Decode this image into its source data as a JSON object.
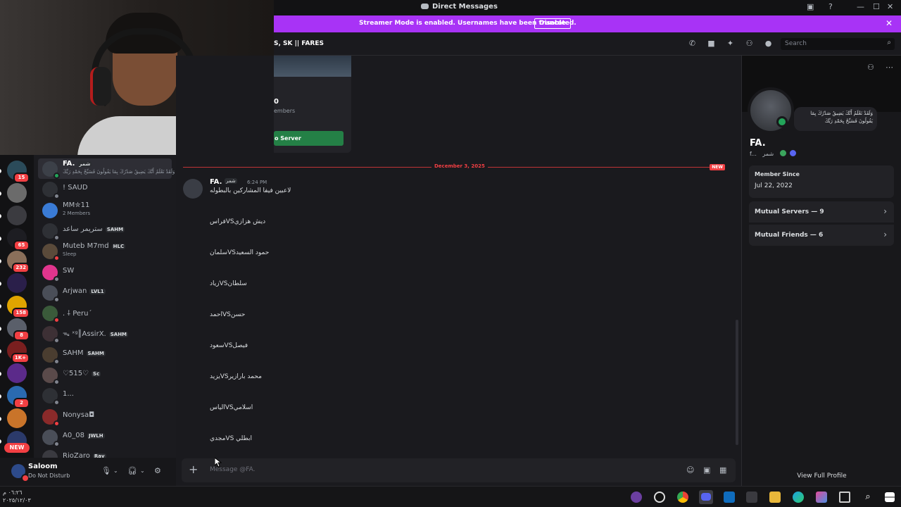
{
  "window": {
    "title": "Direct Messages",
    "controls": [
      "inbox-icon",
      "help-icon",
      "minimize-icon",
      "maximize-icon",
      "close-icon"
    ]
  },
  "banner": {
    "text": "Streamer Mode is enabled. Usernames have been truncated.",
    "button": "Disable"
  },
  "header": {
    "channel_name": "S, SK || FARES",
    "search_placeholder": "Search"
  },
  "servers": [
    {
      "badge": "15",
      "color": "#2b4b5a"
    },
    {
      "badge": "",
      "color": "#6b6b6b"
    },
    {
      "badge": "",
      "color": "#3b3b40"
    },
    {
      "badge": "65",
      "color": "#1d1d22"
    },
    {
      "badge": "232",
      "color": "#8a6f5a"
    },
    {
      "badge": "",
      "color": "#2a1f4a"
    },
    {
      "badge": "158",
      "color": "#e0a400"
    },
    {
      "badge": "8",
      "color": "#5a5f6a"
    },
    {
      "badge": "1K+",
      "color": "#7a1f1f"
    },
    {
      "badge": "",
      "color": "#5b2a8a"
    },
    {
      "badge": "2",
      "color": "#2a6ab0"
    },
    {
      "badge": "",
      "color": "#c9742a"
    },
    {
      "badge": "",
      "color": "#2b3a6a"
    }
  ],
  "rail_new": "NEW",
  "dms": [
    {
      "name": "FA.",
      "tag": "شمر",
      "sub": "وَلَقَدْ نَعْلَمُ أَنَّكَ يَضِيقُ صَدْرُكَ بِمَا يَقُولُونَ فَسَبِّحْ بِحَمْدِ رَبِّكَ",
      "status": "on",
      "selected": true,
      "avatar": "#3c4048"
    },
    {
      "name": "! SAUD",
      "tag": "",
      "sub": "",
      "status": "off",
      "avatar": "#2e3035"
    },
    {
      "name": "MM✮11",
      "tag": "",
      "sub": "2 Members",
      "status": "",
      "avatar": "#3a7bd5"
    },
    {
      "name": "ستريمر ساعد",
      "tag": "SAHM",
      "sub": "",
      "status": "off",
      "avatar": "#2e3035"
    },
    {
      "name": "Muteb M7md",
      "tag": "HLC",
      "sub": "Sleep",
      "status": "dnd",
      "avatar": "#5a4a3a"
    },
    {
      "name": "SW",
      "tag": "",
      "sub": "",
      "status": "off",
      "avatar": "#e0358d"
    },
    {
      "name": "Arjwan",
      "tag": "LVL1",
      "sub": "",
      "status": "off",
      "avatar": "#4a4e58"
    },
    {
      "name": ". ⸸ Peru´",
      "tag": "",
      "sub": "",
      "status": "dnd",
      "avatar": "#3a5a3a"
    },
    {
      "name": "ᯓ ˣᵍ║AssirX.",
      "tag": "SAHM",
      "sub": "",
      "status": "off",
      "avatar": "#3d3035"
    },
    {
      "name": "SAHM",
      "tag": "SAHM",
      "sub": "",
      "status": "off",
      "avatar": "#4a3d30"
    },
    {
      "name": "♡515♡",
      "tag": "Sc",
      "sub": "",
      "status": "off",
      "avatar": "#5a4a4a"
    },
    {
      "name": "1...",
      "tag": "",
      "sub": "",
      "status": "off",
      "avatar": "#2e3035"
    },
    {
      "name": "Nonysa◘",
      "tag": "",
      "sub": "",
      "status": "dnd",
      "avatar": "#8a2a2a"
    },
    {
      "name": "A0_08",
      "tag": "JWLH",
      "sub": "",
      "status": "off",
      "avatar": "#4a4e58"
    },
    {
      "name": "RioZaro",
      "tag": "Rav",
      "sub": "",
      "status": "off",
      "avatar": "#3a3a40"
    }
  ],
  "user": {
    "name": "Saloom",
    "status": "Do Not Disturb"
  },
  "invite": {
    "count": "0",
    "members": "embers",
    "button": "o Server"
  },
  "chat": {
    "date": "December 3, 2025",
    "new_label": "NEW",
    "author": "FA.",
    "author_tag": "شمر",
    "time": "6:24 PM",
    "lines": [
      "لاعبين فيفا المشاركين بالبطوله",
      "فراسVSديش هزازي",
      "سلمانVSحمود السعيد",
      "زيادVSسلطان",
      "احمدVSحسن",
      "سعودVSفيصل",
      "يزيدVSمحمد بارازير",
      "الياسVSاسلامي",
      "مجديVS ابطلي"
    ],
    "composer_placeholder": "Message @FA."
  },
  "profile": {
    "display_name": "FA.",
    "username": "f...",
    "tag": "شمر",
    "bio": "وَلَقَدْ نَعْلَمُ أَنَّكَ يَضِيقُ صَدْرُكَ بِمَا يَقُولُونَ فَسَبِّحْ بِحَمْدِ رَبِّكَ",
    "member_since_label": "Member Since",
    "member_since": "Jul 22, 2022",
    "mutual_servers": "Mutual Servers — 9",
    "mutual_friends": "Mutual Friends — 6",
    "view_full": "View Full Profile"
  },
  "taskbar": {
    "time": "٠٦:٢٦ م",
    "date": "٢٠٢٥/١٢/٠٣"
  }
}
